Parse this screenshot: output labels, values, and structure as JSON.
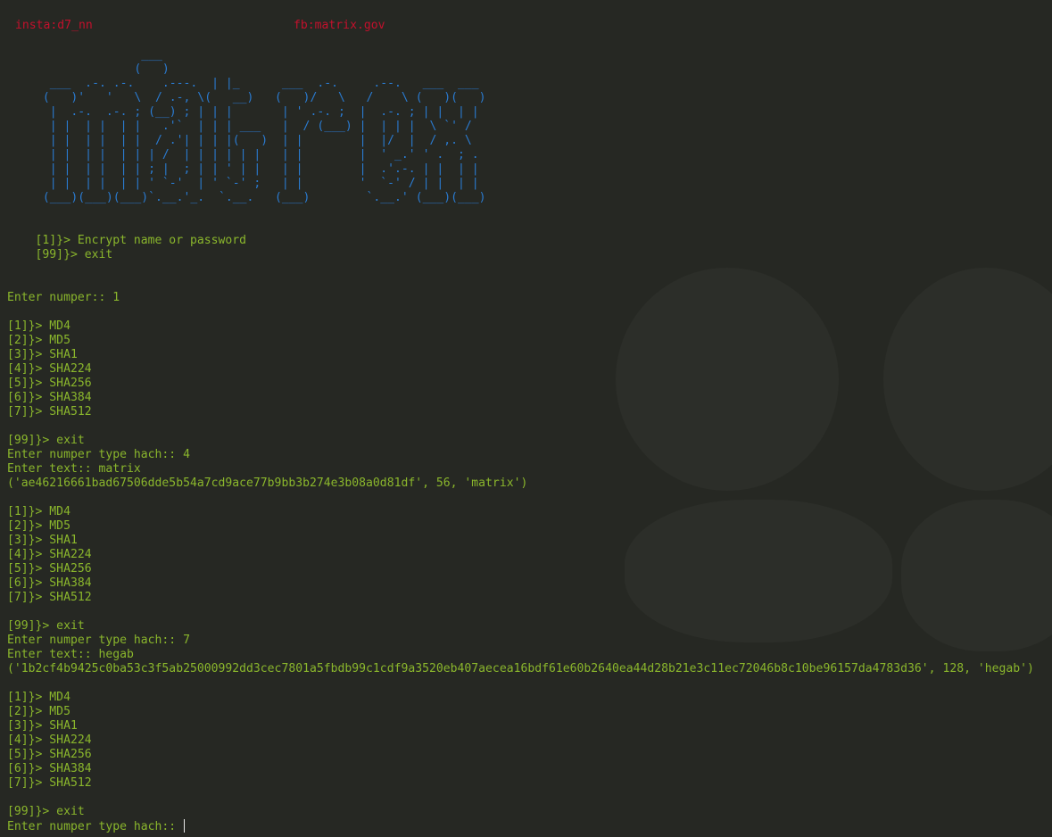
{
  "header": {
    "insta": "insta:d7_nn",
    "fb": "fb:matrix.gov"
  },
  "banner_art": "               ___\n              (   )\n  ___  .-. .-.    .---.  | |_      ___  .-.     .--.   ___  ___\n (   )'   '   \\  / .-, \\(   __)   (   )/   \\   /    \\ (   )(   )\n  |  .-.  .-. ; (__) ; | | |       | ' .-. ;  |  .-. ; | |  | |\n  | |  | |  | |   .'`  | | | ___   |  / (___) |  | | |  \\ `' /\n  | |  | |  | |  / .'| | | |(   )  | |        |  |/  |  / ,. \\\n  | |  | |  | | | /  | | | | | |   | |        |  ' _.' ' .  ; .\n  | |  | |  | | ; |  ; | | ' | |   | |        |  .'.-. | |  | |\n  | |  | |  | | ' `-'  | ' `-' ;   | |        '  `-' / | |  | |\n (___)(___)(___)`.__.'_.  `.__.   (___)        `.__.' (___)(___)",
  "terminal": {
    "menu": [
      "    [1]}> Encrypt name or password",
      "    [99]}> exit"
    ],
    "prompt_1": "Enter numper:: 1",
    "hash_menu": [
      "[1]}> MD4",
      "[2]}> MD5",
      "[3]}> SHA1",
      "[4]}> SHA224",
      "[5]}> SHA256",
      "[6]}> SHA384",
      "[7]}> SHA512"
    ],
    "exit_line": "[99]}> exit",
    "session_1": {
      "type_prompt": "Enter numper type hach:: 4",
      "text_prompt": "Enter text:: matrix",
      "result": "('ae46216661bad67506dde5b54a7cd9ace77b9bb3b274e3b08a0d81df', 56, 'matrix')"
    },
    "session_2": {
      "type_prompt": "Enter numper type hach:: 7",
      "text_prompt": "Enter text:: hegab",
      "result": "('1b2cf4b9425c0ba53c3f5ab25000992dd3cec7801a5fbdb99c1cdf9a3520eb407aecea16bdf61e60b2640ea44d28b21e3c11ec72046b8c10be96157da4783d36', 128, 'hegab')"
    },
    "final_prompt": "Enter numper type hach:: "
  }
}
